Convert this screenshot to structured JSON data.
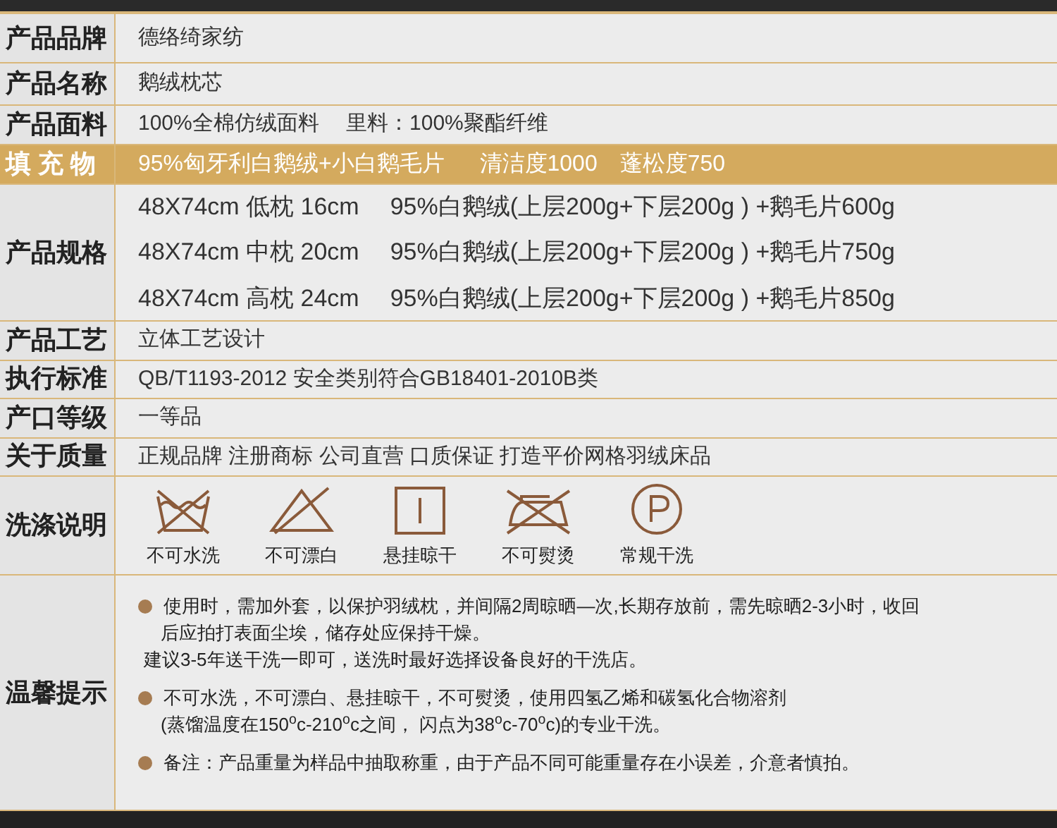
{
  "rows": [
    {
      "kind": "text",
      "label": "产品品牌",
      "value": "德络绮家纺"
    },
    {
      "kind": "text",
      "label": "产品名称",
      "value": "鹅绒枕芯"
    },
    {
      "kind": "text",
      "label": "产品面料",
      "value": "100%全棉仿绒面料　 里料：100%聚酯纤维"
    },
    {
      "kind": "highlight",
      "label": "填 充 物",
      "value": "95%匈牙利白鹅绒+小白鹅毛片　  清洁度1000　蓬松度750"
    },
    {
      "kind": "spec",
      "label": "产品规格",
      "lines": [
        {
          "size": "48X74cm 低枕 16cm",
          "fill": "95%白鹅绒(上层200g+下层200g ) +鹅毛片600g"
        },
        {
          "size": "48X74cm 中枕 20cm",
          "fill": "95%白鹅绒(上层200g+下层200g ) +鹅毛片750g"
        },
        {
          "size": "48X74cm 高枕 24cm",
          "fill": "95%白鹅绒(上层200g+下层200g ) +鹅毛片850g"
        }
      ]
    },
    {
      "kind": "text",
      "label": "产品工艺",
      "value": "立体工艺设计"
    },
    {
      "kind": "text",
      "label": "执行标准",
      "value": "QB/T1193-2012 安全类别符合GB18401-2010B类"
    },
    {
      "kind": "text",
      "label": "产口等级",
      "value": "一等品"
    },
    {
      "kind": "text",
      "label": "关于质量",
      "value": "正规品牌 注册商标 公司直营 口质保证 打造平价网格羽绒床品"
    },
    {
      "kind": "care",
      "label": "洗涤说明",
      "items": [
        {
          "kind": "no-wash",
          "text": "不可水洗"
        },
        {
          "kind": "no-bleach",
          "text": "不可漂白"
        },
        {
          "kind": "hang-dry",
          "text": "悬挂晾干"
        },
        {
          "kind": "no-iron",
          "text": "不可熨烫"
        },
        {
          "kind": "dry-clean",
          "text": "常规干洗"
        }
      ]
    },
    {
      "kind": "notes",
      "label": "温馨提示",
      "notes": [
        {
          "bullet": true,
          "lines": [
            "使用时，需加外套，以保护羽绒枕，并间隔2周晾晒—次,长期存放前，需先晾晒2-3小时，收回",
            "后应拍打表面尘埃，储存处应保持干燥。"
          ]
        },
        {
          "bullet": false,
          "lines": [
            "建议3-5年送干洗一即可，送洗时最好选择设备良好的干洗店。"
          ]
        },
        {
          "bullet": true,
          "lines": [
            "不可水洗，不可漂白、悬挂晾干，不可熨烫，使用四氢乙烯和碳氢化合物溶剂",
            "(蒸馏温度在150$^{o}$c-210$^{o}$c之间， 闪点为38$^{o}$c-70$^{o}$c)的专业干洗。"
          ]
        },
        {
          "bullet": true,
          "lines": [
            "备注：产品重量为样品中抽取称重，由于产品不同可能重量存在小误差，介意者慎拍。"
          ]
        }
      ]
    }
  ]
}
